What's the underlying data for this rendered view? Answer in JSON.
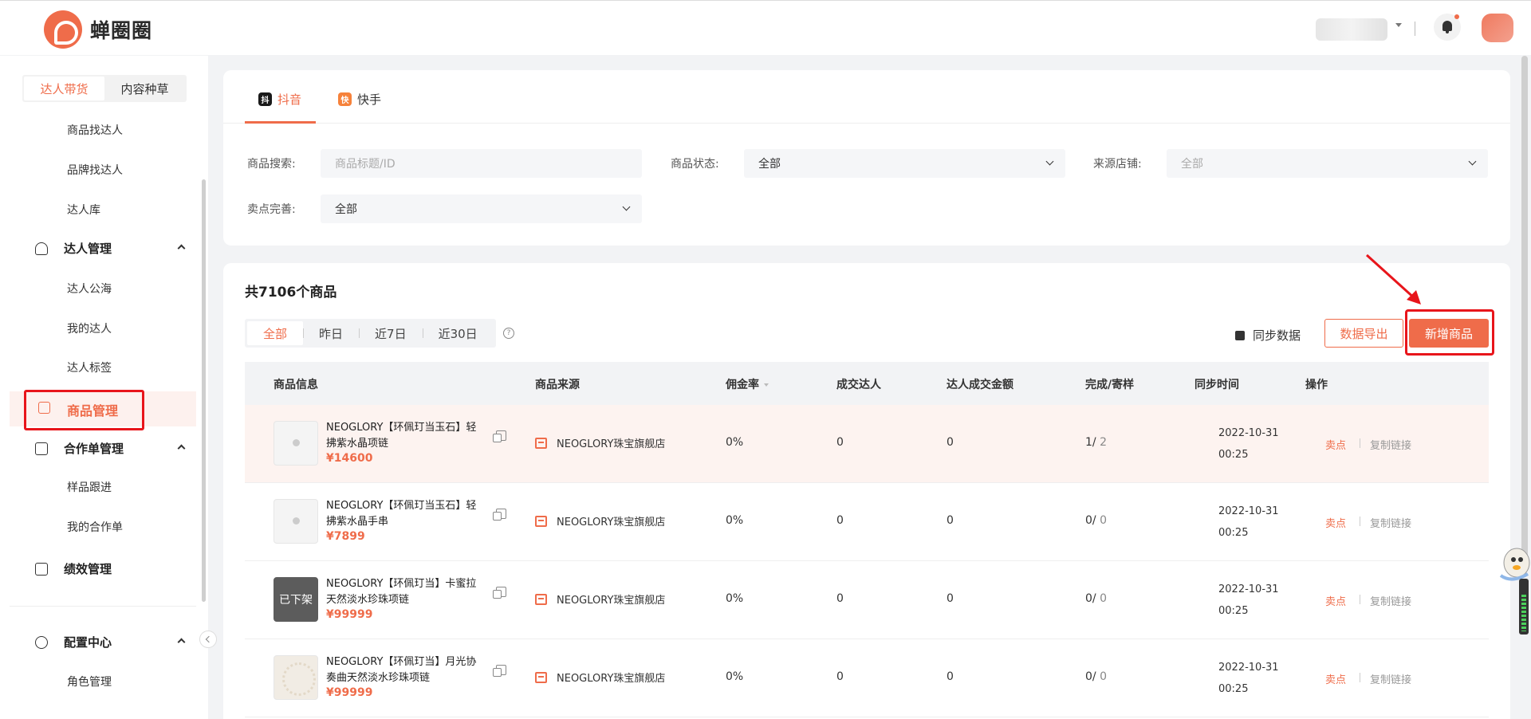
{
  "header": {
    "logo_text": "蝉圈圈"
  },
  "sidebar": {
    "toggle": [
      "达人带货",
      "内容种草"
    ],
    "toggle_active": 0,
    "items": [
      {
        "label": "商品找达人"
      },
      {
        "label": "品牌找达人"
      },
      {
        "label": "达人库"
      },
      {
        "label": "达人管理"
      },
      {
        "label": "达人公海"
      },
      {
        "label": "我的达人"
      },
      {
        "label": "达人标签"
      },
      {
        "label": "商品管理"
      },
      {
        "label": "合作单管理"
      },
      {
        "label": "样品跟进"
      },
      {
        "label": "我的合作单"
      },
      {
        "label": "绩效管理"
      },
      {
        "label": "配置中心"
      },
      {
        "label": "角色管理"
      }
    ],
    "active": "商品管理"
  },
  "platform_tabs": [
    {
      "label": "抖音",
      "icon": "douyin-icon",
      "icon_text": "抖",
      "color": "#1a1a1a"
    },
    {
      "label": "快手",
      "icon": "kuaishou-icon",
      "icon_text": "快",
      "color": "#f6823b"
    }
  ],
  "filters": {
    "search_label": "商品搜索:",
    "search_placeholder": "商品标题/ID",
    "status_label": "商品状态:",
    "status_value": "全部",
    "shop_label": "来源店铺:",
    "shop_value": "全部",
    "selling_label": "卖点完善:",
    "selling_value": "全部"
  },
  "list": {
    "total": "共7106个商品",
    "ranges": [
      "全部",
      "昨日",
      "近7日",
      "近30日"
    ],
    "range_active": 0,
    "help": "?",
    "sync_label": "同步数据",
    "export_label": "数据导出",
    "add_label": "新增商品",
    "columns": [
      "商品信息",
      "商品来源",
      "佣金率",
      "成交达人",
      "达人成交金额",
      "完成/寄样",
      "同步时间",
      "操作"
    ],
    "rows": [
      {
        "name": "NEOGLORY【环佩玎当玉石】轻拂紫水晶项链",
        "price": "¥14600",
        "thumb": "gem",
        "thumb_text": "",
        "shop": "NEOGLORY珠宝旗舰店",
        "commission": "0%",
        "deal_talents": "0",
        "deal_amount": "0",
        "done": "1/",
        "sample": "2",
        "date": "2022-10-31",
        "time": "00:25",
        "op1": "卖点",
        "op2": "复制链接"
      },
      {
        "name": "NEOGLORY【环佩玎当玉石】轻拂紫水晶手串",
        "price": "¥7899",
        "thumb": "gem",
        "thumb_text": "",
        "shop": "NEOGLORY珠宝旗舰店",
        "commission": "0%",
        "deal_talents": "0",
        "deal_amount": "0",
        "done": "0/",
        "sample": "0",
        "date": "2022-10-31",
        "time": "00:25",
        "op1": "卖点",
        "op2": "复制链接"
      },
      {
        "name": "NEOGLORY【环佩玎当】卡蜜拉天然淡水珍珠项链",
        "price": "¥99999",
        "thumb": "off",
        "thumb_text": "已下架",
        "shop": "NEOGLORY珠宝旗舰店",
        "commission": "0%",
        "deal_talents": "0",
        "deal_amount": "0",
        "done": "0/",
        "sample": "0",
        "date": "2022-10-31",
        "time": "00:25",
        "op1": "卖点",
        "op2": "复制链接"
      },
      {
        "name": "NEOGLORY【环佩玎当】月光协奏曲天然淡水珍珠项链",
        "price": "¥99999",
        "thumb": "pearl",
        "thumb_text": "",
        "shop": "NEOGLORY珠宝旗舰店",
        "commission": "0%",
        "deal_talents": "0",
        "deal_amount": "0",
        "done": "0/",
        "sample": "0",
        "date": "2022-10-31",
        "time": "00:25",
        "op1": "卖点",
        "op2": "复制链接"
      }
    ]
  },
  "colors": {
    "accent": "#ef6c4a",
    "highlight": "#e8151b"
  }
}
